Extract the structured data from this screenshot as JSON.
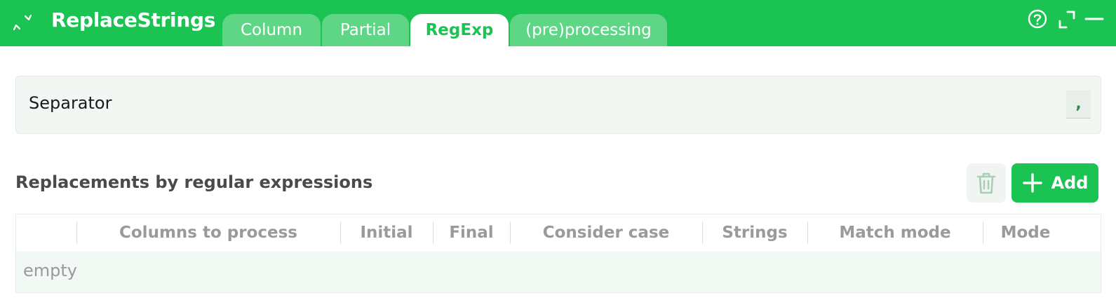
{
  "header": {
    "title": "ReplaceStrings",
    "app_icon": "refresh-arrows-icon",
    "tabs": [
      {
        "label": "Column",
        "active": false
      },
      {
        "label": "Partial",
        "active": false
      },
      {
        "label": "RegExp",
        "active": true
      },
      {
        "label": "(pre)processing",
        "active": false
      }
    ],
    "buttons": [
      "help-icon",
      "expand-icon",
      "minimize-icon"
    ],
    "color": "#1ac352"
  },
  "separator": {
    "label": "Separator",
    "value": ","
  },
  "replacements": {
    "title": "Replacements by regular expressions",
    "delete_icon": "trash-icon",
    "add_label": "Add",
    "columns": [
      "",
      "Columns to process",
      "Initial",
      "Final",
      "Consider case",
      "Strings",
      "Match mode",
      "Mode"
    ],
    "empty_text": "empty"
  }
}
